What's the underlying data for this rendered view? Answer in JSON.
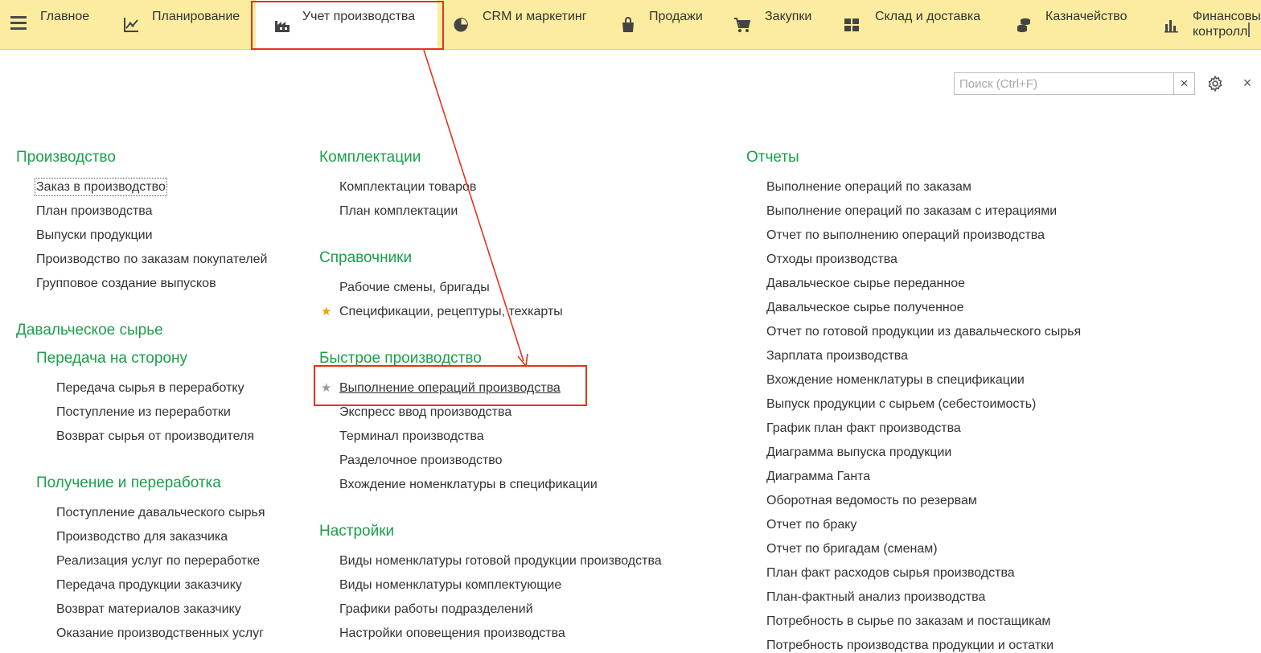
{
  "topbar": {
    "sections": [
      {
        "label": "Главное",
        "icon": "list-icon"
      },
      {
        "label": "Планирование",
        "icon": "planning-chart-icon"
      },
      {
        "label": "Учет производства",
        "icon": "factory-icon"
      },
      {
        "label": "CRM и маркетинг",
        "icon": "pie-chart-icon"
      },
      {
        "label": "Продажи",
        "icon": "shopping-bag-icon"
      },
      {
        "label": "Закупки",
        "icon": "shopping-cart-icon"
      },
      {
        "label": "Склад и доставка",
        "icon": "warehouse-grid-icon"
      },
      {
        "label": "Казначейство",
        "icon": "coins-icon"
      },
      {
        "label_line1": "Финансовый",
        "label_line2": "контролл",
        "icon": "bar-chart-icon"
      }
    ]
  },
  "search": {
    "placeholder": "Поиск (Ctrl+F)",
    "value": "",
    "clear": "×"
  },
  "panel_close": "×",
  "columns": {
    "production": {
      "title": "Производство",
      "items": [
        "Заказ в производство",
        "План производства",
        "Выпуски продукции",
        "Производство по заказам покупателей",
        "Групповое создание выпусков"
      ]
    },
    "tolling": {
      "title": "Давальческое сырье",
      "transfer": {
        "title": "Передача на сторону",
        "items": [
          "Передача сырья в переработку",
          "Поступление из переработки",
          "Возврат сырья от производителя"
        ]
      },
      "receiving": {
        "title": "Получение и переработка",
        "items": [
          "Поступление давальческого сырья",
          "Производство для заказчика",
          "Реализация услуг по переработке",
          "Передача продукции заказчику",
          "Возврат материалов заказчику",
          "Оказание производственных услуг"
        ]
      }
    },
    "kits": {
      "title": "Комплектации",
      "items": [
        "Комплектации товаров",
        "План комплектации"
      ]
    },
    "references": {
      "title": "Справочники",
      "items": [
        "Рабочие смены, бригады",
        "Спецификации, рецептуры, техкарты"
      ]
    },
    "quick": {
      "title": "Быстрое производство",
      "items": [
        "Выполнение операций производства",
        "Экспресс ввод производства",
        "Терминал производства",
        "Разделочное производство",
        "Вхождение номенклатуры в спецификации"
      ]
    },
    "settings": {
      "title": "Настройки",
      "items": [
        "Виды номенклатуры готовой продукции производства",
        "Виды номенклатуры комплектующие",
        "Графики работы подразделений",
        "Настройки оповещения производства"
      ]
    },
    "reports": {
      "title": "Отчеты",
      "items": [
        "Выполнение операций по заказам",
        "Выполнение операций по заказам с итерациями",
        "Отчет по выполнению операций производства",
        "Отходы производства",
        "Давальческое сырье переданное",
        "Давальческое сырье полученное",
        "Отчет по готовой продукции из давальческого сырья",
        "Зарплата производства",
        "Вхождение номенклатуры в спецификации",
        "Выпуск продукции с сырьем (себестоимость)",
        "График план факт производства",
        "Диаграмма выпуска продукции",
        "Диаграмма Ганта",
        "Оборотная ведомость по резервам",
        "Отчет по браку",
        "Отчет по бригадам (сменам)",
        "План факт расходов сырья производства",
        "План-фактный анализ производства",
        "Потребность в сырье по заказам и постащикам",
        "Потребность производства продукции и остатки"
      ]
    }
  },
  "colors": {
    "topbar": "#fbeca0",
    "heading": "#1aa04a",
    "highlight": "#e2341d",
    "star": "#f2a100"
  }
}
